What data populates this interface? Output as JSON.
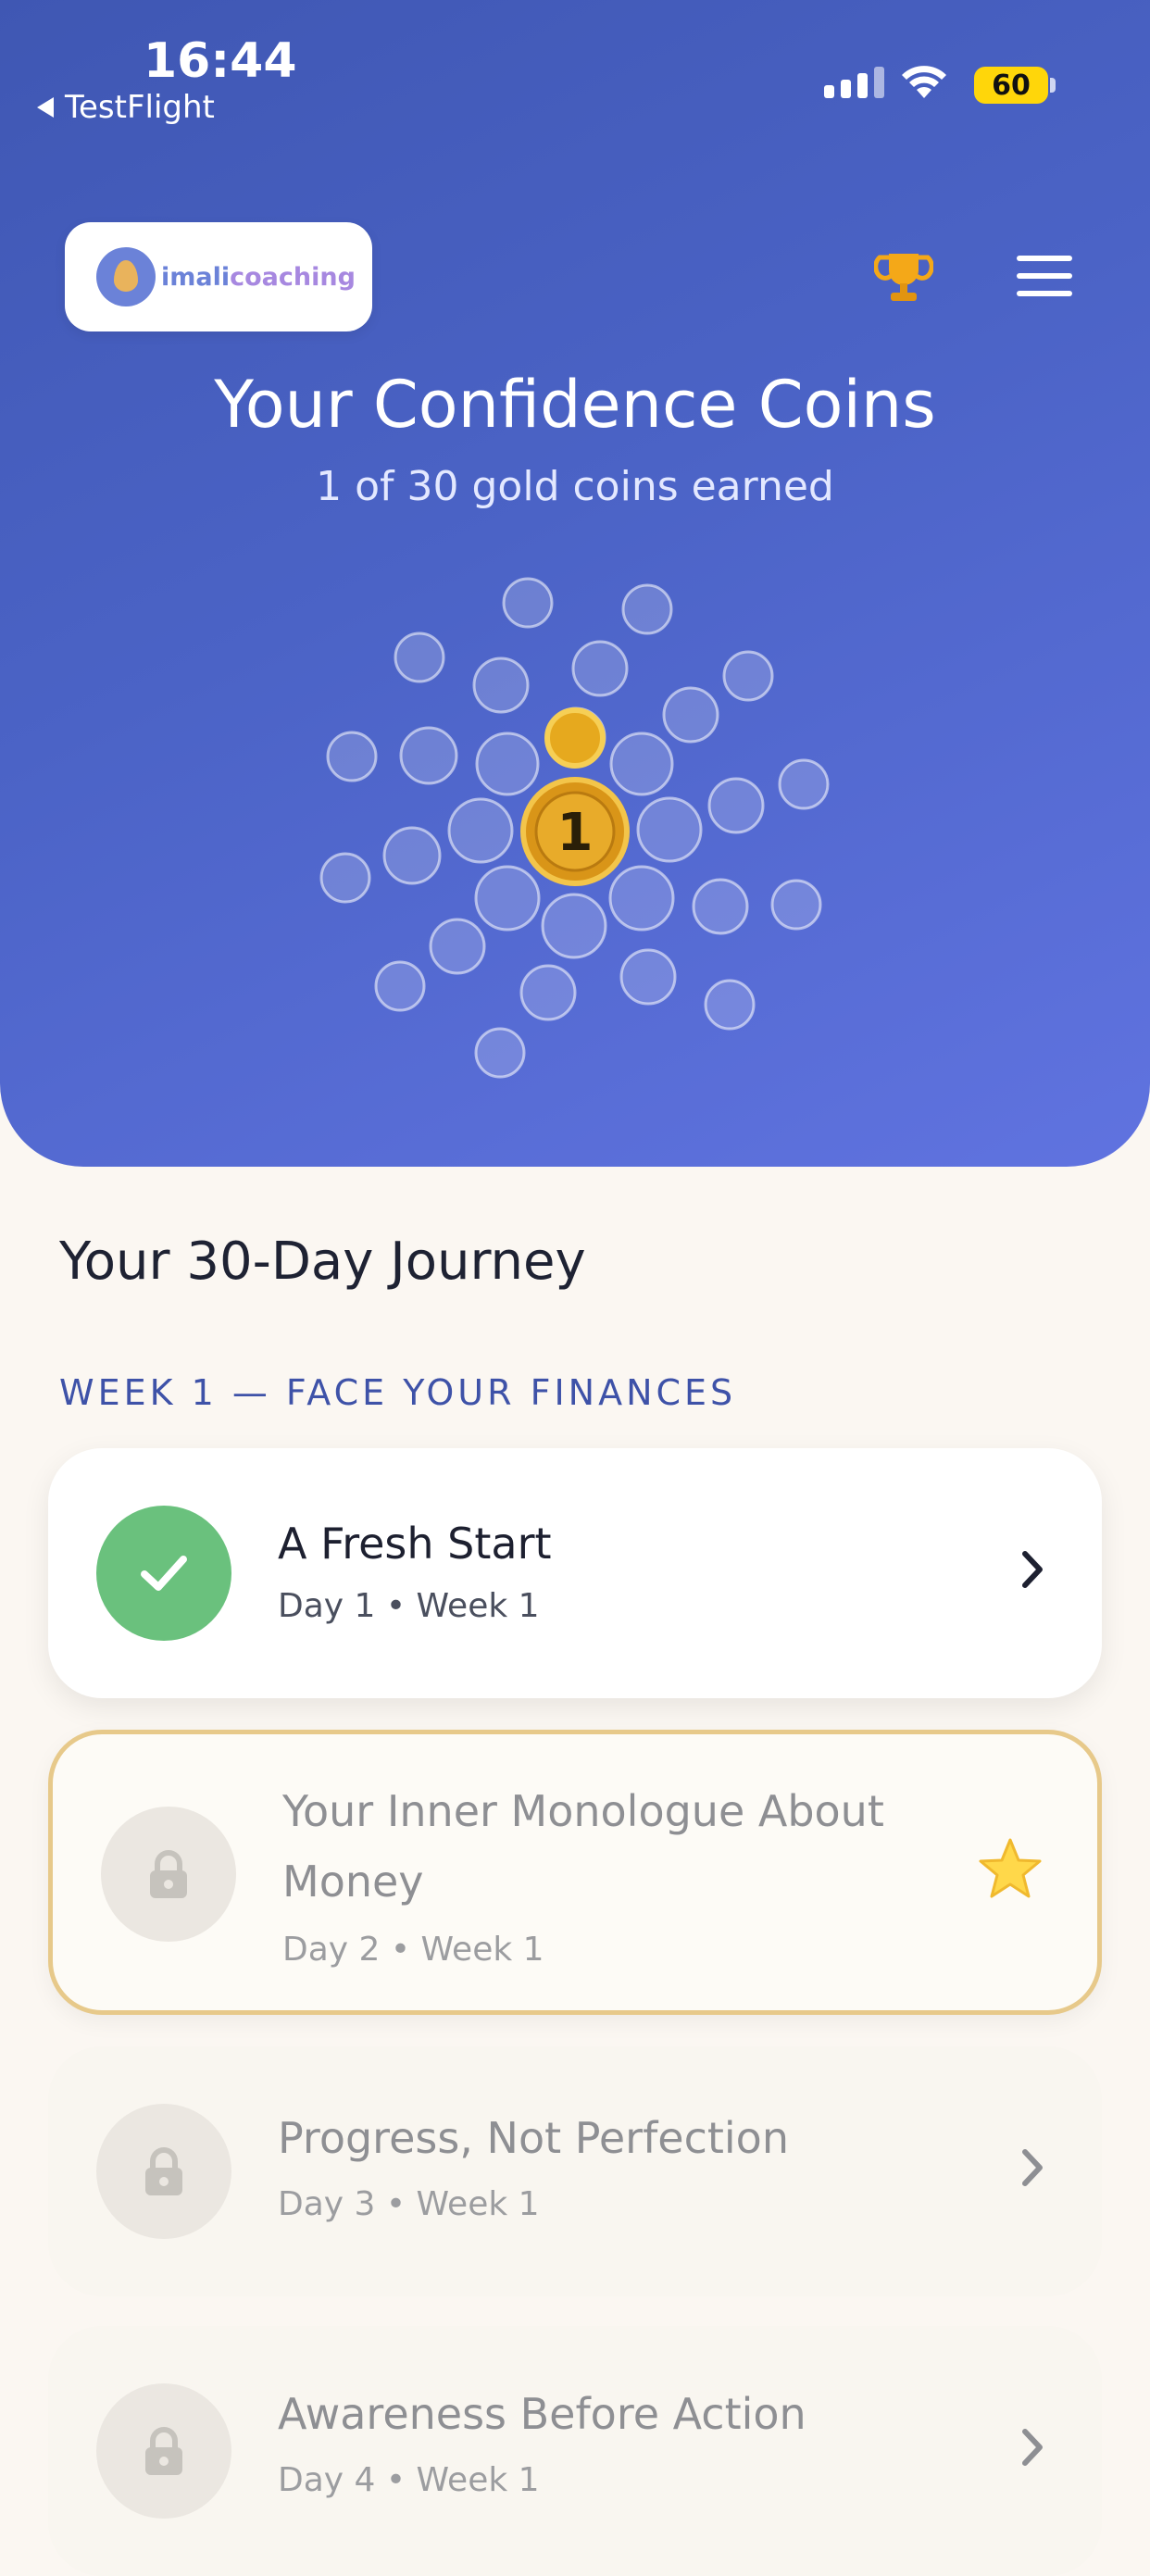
{
  "status_bar": {
    "time": "16:44",
    "back_app": "TestFlight",
    "battery": "60"
  },
  "header": {
    "logo": {
      "prefix": "imali",
      "suffix": "coaching"
    },
    "trophy_icon": "trophy-icon",
    "menu_icon": "hamburger-menu-icon"
  },
  "hero": {
    "title": "Your Confidence Coins",
    "subtitle": "1 of 30 gold coins earned",
    "current_coin": "1",
    "coins_earned": 1,
    "coins_total": 30
  },
  "journey": {
    "title": "Your 30-Day Journey",
    "week_label": "WEEK 1 — FACE YOUR FINANCES",
    "days": [
      {
        "title": "A Fresh Start",
        "meta": "Day 1 • Week 1",
        "status": "completed"
      },
      {
        "title": "Your Inner Monologue About",
        "title_line2": "Money",
        "meta": "Day 2 • Week 1",
        "status": "locked-current"
      },
      {
        "title": "Progress, Not Perfection",
        "meta": "Day 3 • Week 1",
        "status": "locked"
      },
      {
        "title": "Awareness Before Action",
        "meta": "Day 4 • Week 1",
        "status": "locked"
      }
    ]
  },
  "colors": {
    "hero_gradient_start": "#3f57b3",
    "hero_gradient_end": "#6073e0",
    "page_background": "#fbf7f2",
    "completed_green": "#6ac17d",
    "highlight_border": "#e7c98a",
    "week_label": "#3e52a8",
    "gold": "#e0a020"
  }
}
